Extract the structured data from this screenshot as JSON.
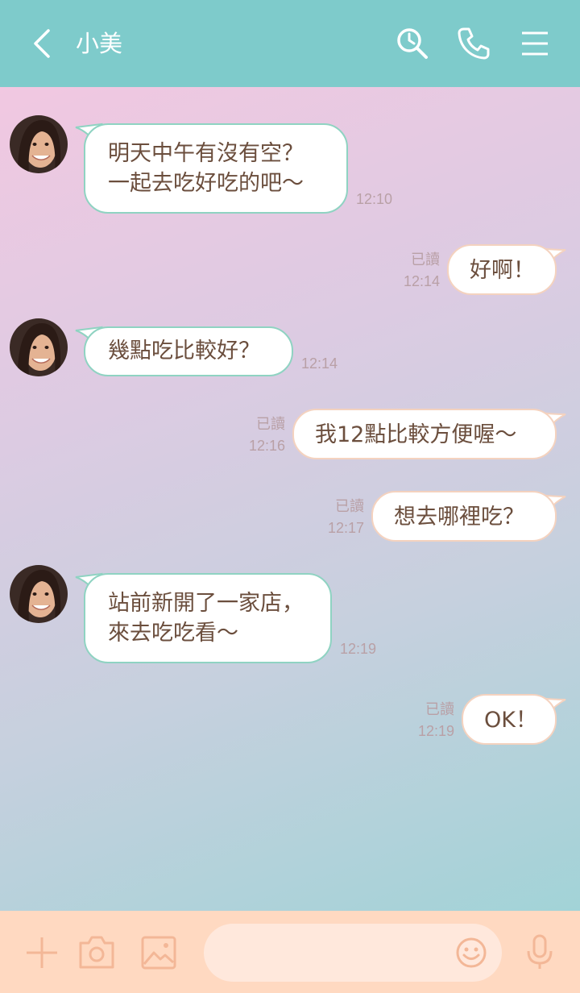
{
  "header": {
    "title": "小美"
  },
  "messages": [
    {
      "from": "contact",
      "lines": [
        "明天中午有沒有空？",
        "一起去吃好吃的吧〜"
      ],
      "time": "12:10"
    },
    {
      "from": "me",
      "lines": [
        "好啊！"
      ],
      "read": "已讀",
      "time": "12:14"
    },
    {
      "from": "contact",
      "lines": [
        "幾點吃比較好？"
      ],
      "time": "12:14"
    },
    {
      "from": "me",
      "lines": [
        "我12點比較方便喔〜"
      ],
      "read": "已讀",
      "time": "12:16"
    },
    {
      "from": "me",
      "lines": [
        "想去哪裡吃？"
      ],
      "read": "已讀",
      "time": "12:17"
    },
    {
      "from": "contact",
      "lines": [
        "站前新開了一家店，",
        "來去吃吃看〜"
      ],
      "time": "12:19"
    },
    {
      "from": "me",
      "lines": [
        "OK！"
      ],
      "read": "已讀",
      "time": "12:19"
    }
  ],
  "input": {
    "placeholder": ""
  },
  "colors": {
    "header_bg": "#7ecbcb",
    "incoming_border": "#8fd3c2",
    "outgoing_border": "#f4d2bf",
    "text": "#6b4e3d",
    "meta": "#b9a0a6",
    "input_bar_bg": "#ffd9c1",
    "input_icon": "#f3b797"
  },
  "icons": {
    "back": "back-chevron-icon",
    "search": "search-icon",
    "call": "phone-icon",
    "menu": "menu-icon",
    "add": "plus-icon",
    "camera": "camera-icon",
    "image": "image-icon",
    "emoji": "emoji-icon",
    "voice": "microphone-icon"
  }
}
